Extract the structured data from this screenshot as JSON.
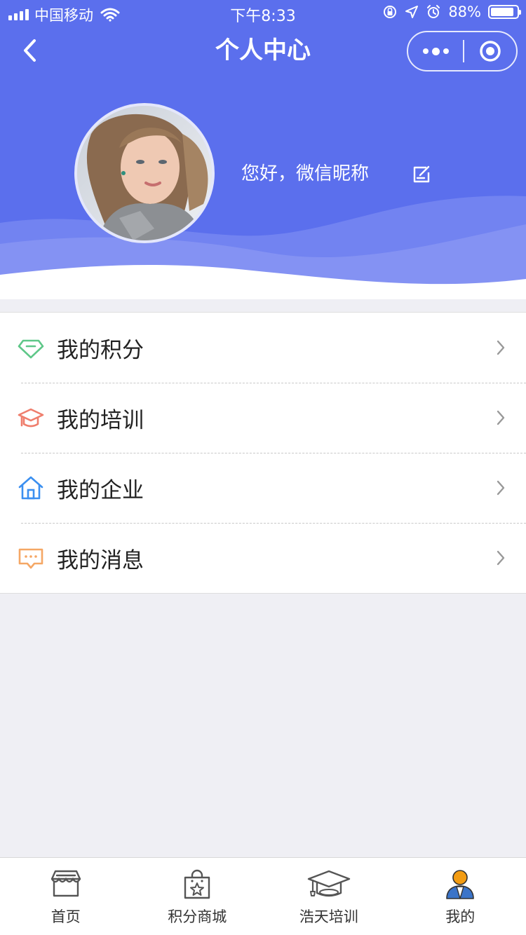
{
  "status_bar": {
    "carrier": "中国移动",
    "time": "下午8:33",
    "battery_percent": "88%",
    "battery_level": 0.88
  },
  "nav": {
    "title": "个人中心",
    "back_icon": "chevron-left-icon",
    "more_icon": "more-dots-icon",
    "close_icon": "target-close-icon"
  },
  "profile": {
    "greeting": "您好，微信昵称",
    "avatar_icon": "user-avatar-photo",
    "edit_icon": "edit-note-icon"
  },
  "menu": {
    "items": [
      {
        "label": "我的积分",
        "icon": "diamond-icon",
        "color": "#5ec788"
      },
      {
        "label": "我的培训",
        "icon": "graduation-cap-icon",
        "color": "#ef7e6d"
      },
      {
        "label": "我的企业",
        "icon": "house-icon",
        "color": "#3b8ff0"
      },
      {
        "label": "我的消息",
        "icon": "message-bubble-icon",
        "color": "#f5a765"
      }
    ]
  },
  "tabbar": {
    "tabs": [
      {
        "label": "首页",
        "icon": "store-icon"
      },
      {
        "label": "积分商城",
        "icon": "shopping-bag-star-icon"
      },
      {
        "label": "浩天培训",
        "icon": "graduation-cap-icon"
      },
      {
        "label": "我的",
        "icon": "person-icon",
        "active": true
      }
    ]
  },
  "colors": {
    "header_bg": "#5b6fed",
    "page_bg": "#efeff4",
    "active_person": "#f39c12"
  }
}
